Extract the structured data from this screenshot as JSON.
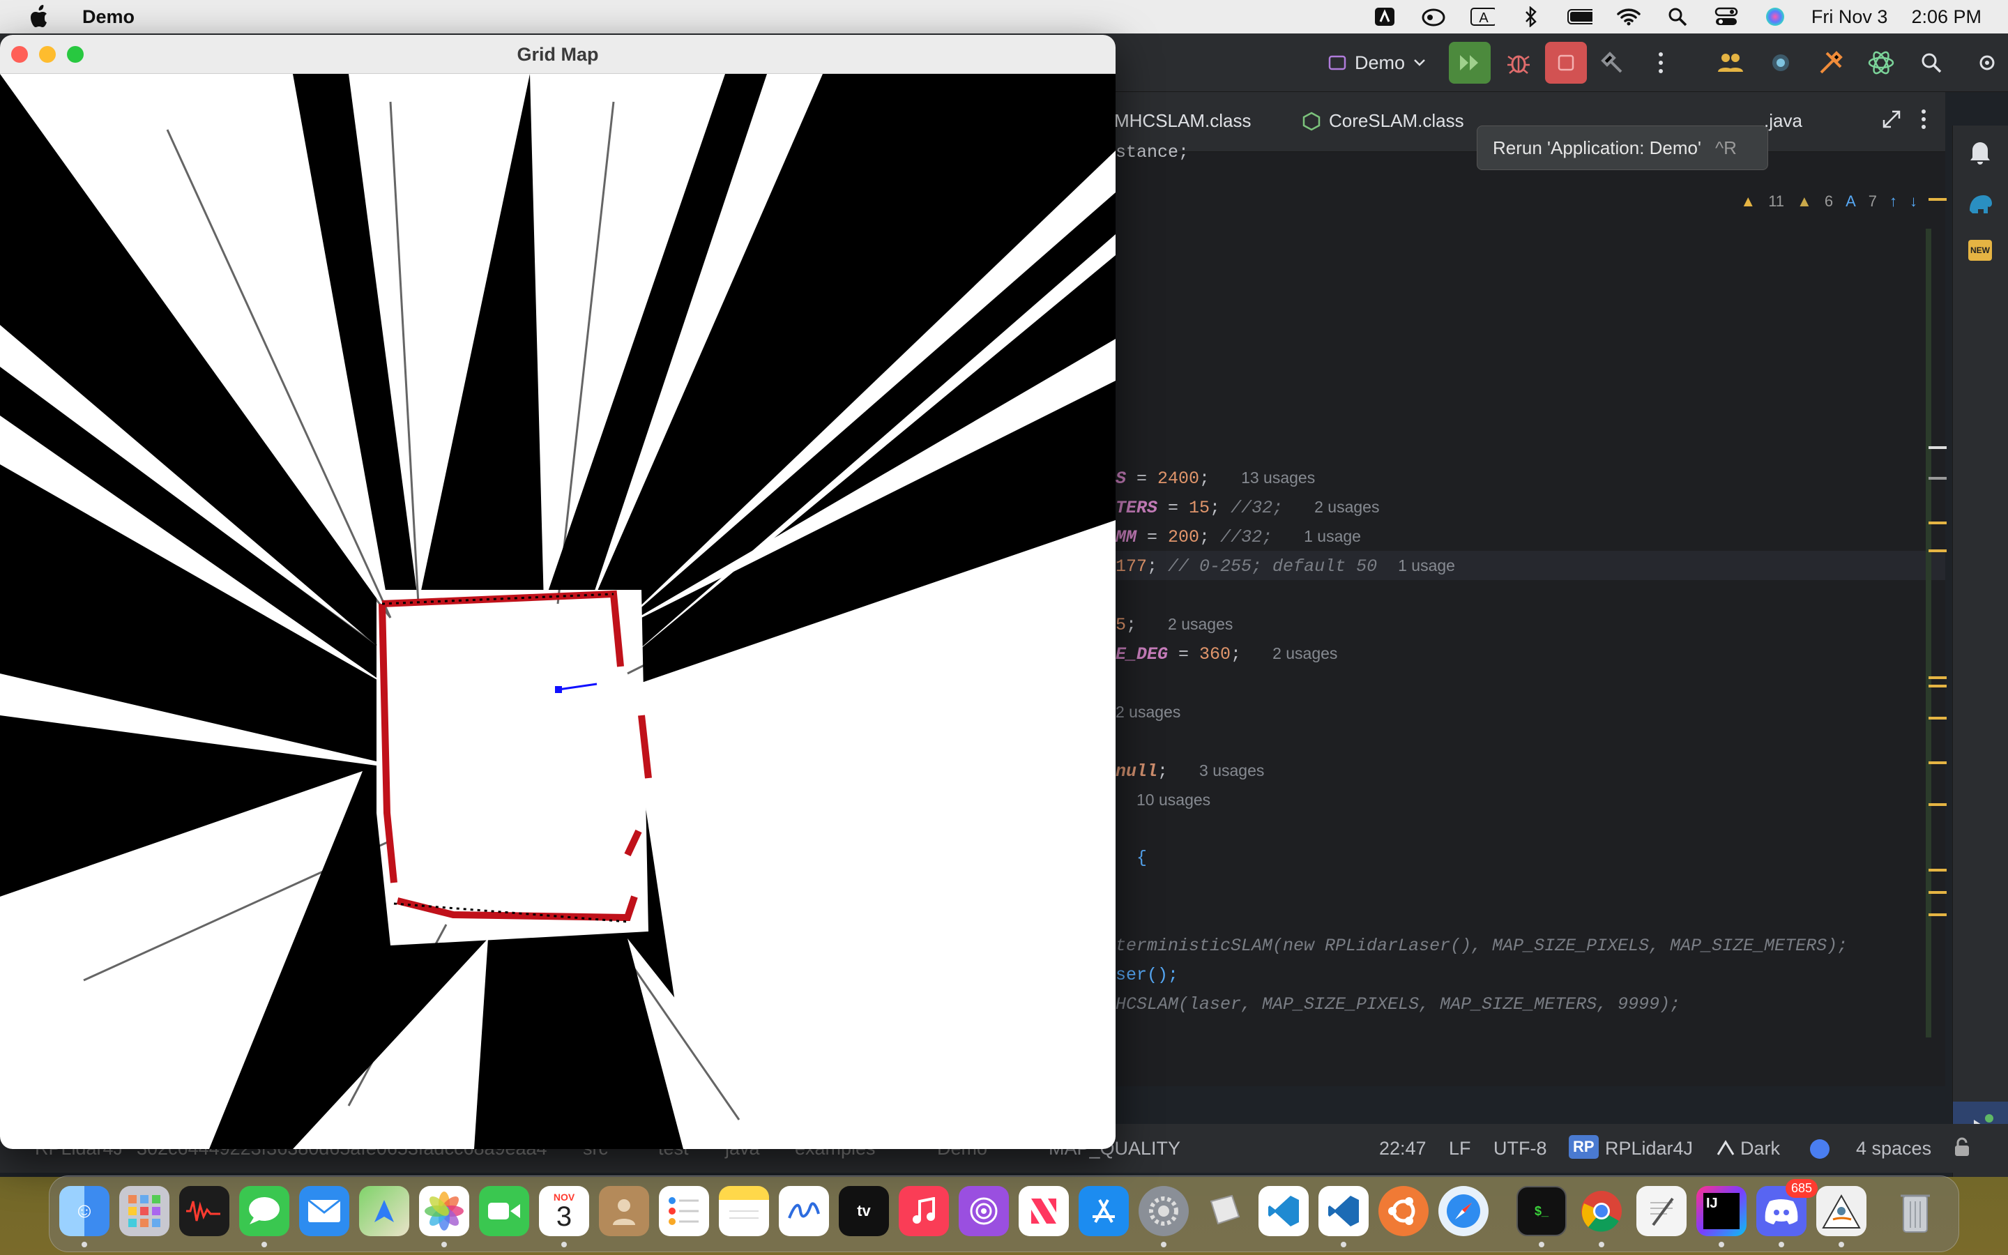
{
  "menubar": {
    "app_name": "Demo",
    "date": "Fri Nov 3",
    "time": "2:06 PM",
    "icons": [
      "apple-logo",
      "a-menu-icon",
      "creative-cloud-icon",
      "input-a-icon",
      "bluetooth-icon",
      "battery-icon",
      "wifi-icon",
      "spotlight-icon",
      "control-center-icon",
      "siri-icon"
    ]
  },
  "grid_window": {
    "title": "Grid Map"
  },
  "ide": {
    "run_config": "Demo",
    "tabs": [
      {
        "label": "MHCSLAM.class"
      },
      {
        "label": "CoreSLAM.class"
      },
      {
        "label": ".java"
      }
    ],
    "tooltip": {
      "text": "Rerun 'Application: Demo'",
      "shortcut": "^R"
    },
    "inspections": {
      "warnings": "11",
      "weak": "6",
      "typos": "7"
    },
    "code": [
      {
        "text": "stance;",
        "cls": "plain"
      },
      {
        "a": "S",
        "b": " = ",
        "n": "2400",
        "c": ";",
        "u": "13 usages"
      },
      {
        "a": "TERS",
        "b": " = ",
        "n": "15",
        "c": "; ",
        "cm": "//32;",
        "u": "2 usages"
      },
      {
        "a": "MM",
        "b": " = ",
        "n": "200",
        "c": "; ",
        "cm": "//32;",
        "u": "1 usage"
      },
      {
        "n": "177",
        "c": "; ",
        "cm": "// 0-255; default 50",
        "u": "1 usage"
      },
      {
        "n": "5",
        "c": ";",
        "u": "2 usages"
      },
      {
        "a": "E_DEG",
        "b": " = ",
        "n": "360",
        "c": ";",
        "u": "2 usages"
      },
      {
        "u": "2 usages"
      },
      {
        "kw": "null",
        "c": ";",
        "u": "3 usages"
      },
      {
        "u": "10 usages"
      },
      {
        "text": "{",
        "cls": "plain"
      },
      {
        "text": "terministicSLAM(new RPLidarLaser(), MAP_SIZE_PIXELS, MAP_SIZE_METERS);",
        "cls": "cmt"
      },
      {
        "text": "ser();",
        "cls": "fn"
      },
      {
        "text": "HCSLAM(laser, MAP_SIZE_PIXELS, MAP_SIZE_METERS, 9999);",
        "cls": "cmt"
      }
    ],
    "status": {
      "breadcrumb": [
        "RPLidar4J",
        "302c64449223f36380d65afe0653fadcc68a9eaa4",
        "src",
        "test",
        "java",
        "examples",
        "Demo",
        "MAP_QUALITY"
      ],
      "position": "22:47",
      "line_sep": "LF",
      "encoding": "UTF-8",
      "project_badge": "RP",
      "project": "RPLidar4J",
      "theme": "Dark",
      "indent": "4 spaces"
    }
  },
  "dock": {
    "calendar_month": "NOV",
    "calendar_day": "3",
    "discord_badge": "685",
    "apps": [
      "finder",
      "launchpad",
      "voice-memos",
      "messages",
      "mail",
      "maps",
      "photos",
      "facetime",
      "calendar",
      "contacts",
      "reminders",
      "notes",
      "freeform",
      "apple-tv",
      "music",
      "podcasts",
      "news",
      "app-store",
      "system-settings",
      "sandbox",
      "vscode",
      "vscode-insiders",
      "ubuntu",
      "safari",
      "terminal",
      "chrome",
      "textedit",
      "intellij",
      "discord",
      "java",
      "trash"
    ]
  }
}
